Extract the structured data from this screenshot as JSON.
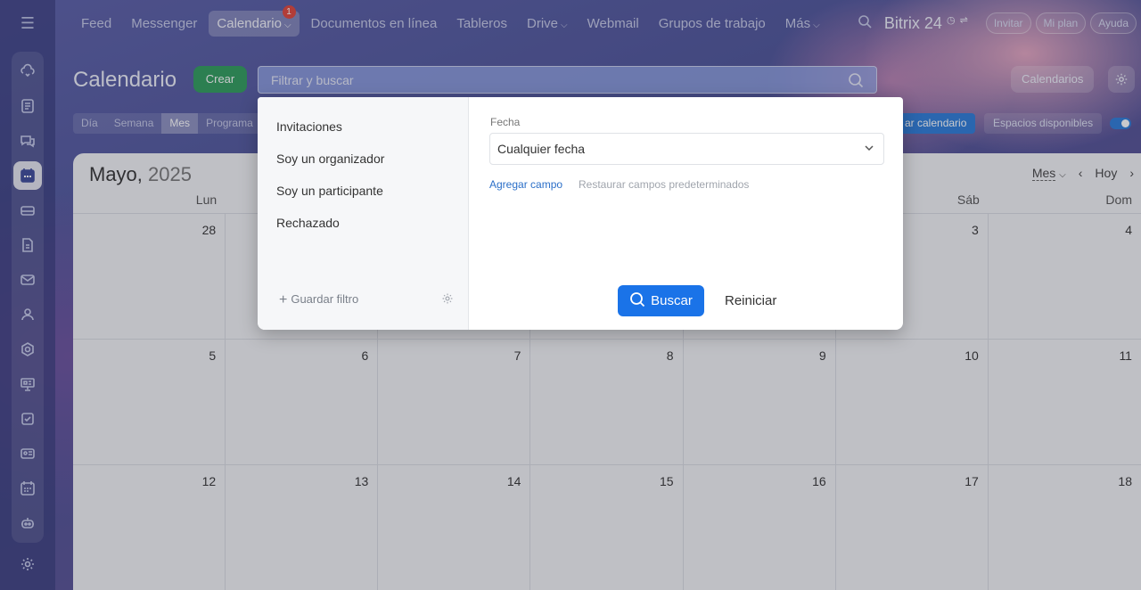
{
  "sidebar": {
    "items": [
      {
        "icon": "cloud-sync-icon"
      },
      {
        "icon": "news-feed-icon"
      },
      {
        "icon": "chat-icon"
      },
      {
        "icon": "calendar-icon",
        "active": true
      },
      {
        "icon": "disk-icon"
      },
      {
        "icon": "document-icon"
      },
      {
        "icon": "mail-icon"
      },
      {
        "icon": "groups-icon"
      },
      {
        "icon": "crm-icon"
      },
      {
        "icon": "presentation-icon"
      },
      {
        "icon": "tasks-icon"
      },
      {
        "icon": "contact-card-icon"
      },
      {
        "icon": "planner-icon"
      },
      {
        "icon": "robot-icon"
      }
    ]
  },
  "topnav": {
    "items": [
      {
        "label": "Feed"
      },
      {
        "label": "Messenger"
      },
      {
        "label": "Calendario",
        "badge": "1",
        "active": true
      },
      {
        "label": "Documentos en línea"
      },
      {
        "label": "Tableros"
      },
      {
        "label": "Drive"
      },
      {
        "label": "Webmail"
      },
      {
        "label": "Grupos de trabajo"
      },
      {
        "label": "Más"
      }
    ],
    "brand": "Bitrix 24",
    "invite_label": "Invitar",
    "plan_label": "Mi plan",
    "help_label": "Ayuda"
  },
  "header": {
    "title": "Calendario",
    "create_label": "Crear",
    "search_placeholder": "Filtrar y buscar",
    "calendars_label": "Calendarios"
  },
  "views": {
    "tabs": [
      "Día",
      "Semana",
      "Mes",
      "Programa"
    ],
    "active": "Mes",
    "sync_label": "ar calendario",
    "slots_label": "Espacios disponibles"
  },
  "calendar": {
    "month": "Mayo,",
    "year": "2025",
    "view_select": "Mes",
    "today_label": "Hoy",
    "day_names": [
      "Lun",
      "",
      "",
      "",
      "",
      "Sáb",
      "Dom"
    ],
    "weeks": [
      [
        "28",
        "",
        "",
        "",
        "",
        "3",
        "4"
      ],
      [
        "5",
        "6",
        "7",
        "8",
        "9",
        "10",
        "11"
      ],
      [
        "12",
        "13",
        "14",
        "15",
        "16",
        "17",
        "18"
      ]
    ]
  },
  "filter_popup": {
    "presets": [
      "Invitaciones",
      "Soy un organizador",
      "Soy un participante",
      "Rechazado"
    ],
    "save_filter_label": "Guardar filtro",
    "date_field_label": "Fecha",
    "date_value": "Cualquier fecha",
    "add_field_label": "Agregar campo",
    "restore_fields_label": "Restaurar campos predeterminados",
    "search_button": "Buscar",
    "reset_button": "Reiniciar"
  },
  "colors": {
    "accent": "#1a73e8",
    "create": "#2e9c5b",
    "badge": "#e0443a"
  }
}
